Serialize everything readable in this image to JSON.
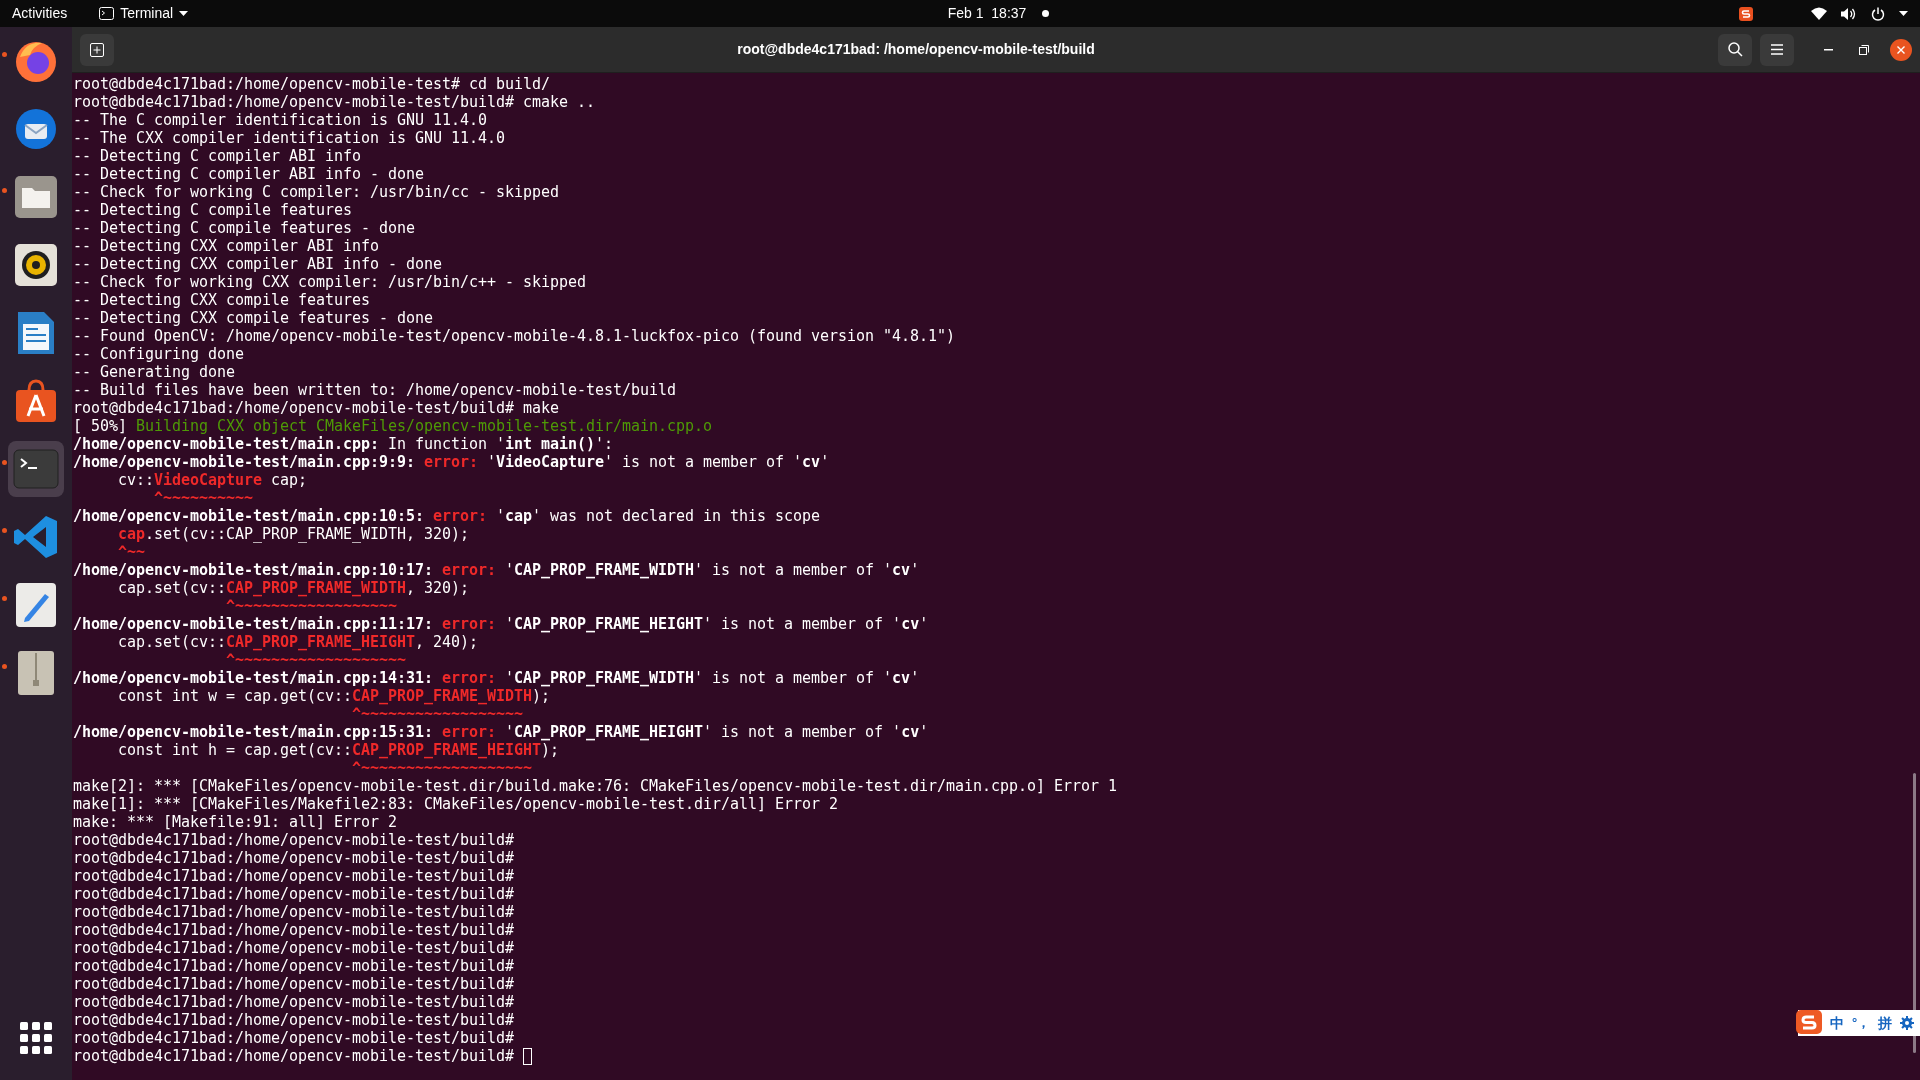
{
  "top_bar": {
    "activities": "Activities",
    "app_menu": "Terminal",
    "clock": "Feb 1  18:37",
    "notification_dot": true
  },
  "dock": [
    {
      "kind": "firefox",
      "running": true,
      "selected": false
    },
    {
      "kind": "thunderbird",
      "running": false,
      "selected": false
    },
    {
      "kind": "files",
      "running": true,
      "selected": false
    },
    {
      "kind": "rhythmbox",
      "running": false,
      "selected": false
    },
    {
      "kind": "writer",
      "running": false,
      "selected": false
    },
    {
      "kind": "appstore",
      "running": false,
      "selected": false
    },
    {
      "kind": "terminal",
      "running": true,
      "selected": true
    },
    {
      "kind": "vscode",
      "running": true,
      "selected": false
    },
    {
      "kind": "editor",
      "running": true,
      "selected": false
    },
    {
      "kind": "archive",
      "running": true,
      "selected": false
    },
    {
      "kind": "appgrid",
      "running": false,
      "selected": false
    }
  ],
  "window": {
    "title": "root@dbde4c171bad: /home/opencv-mobile-test/build"
  },
  "terminal": {
    "cursor_visible": true,
    "lines": [
      {
        "segments": [
          {
            "kind": "plain",
            "text": "root@dbde4c171bad:/home/opencv-mobile-test# cd build/"
          }
        ]
      },
      {
        "segments": [
          {
            "kind": "plain",
            "text": "root@dbde4c171bad:/home/opencv-mobile-test/build# cmake .."
          }
        ]
      },
      {
        "segments": [
          {
            "kind": "plain",
            "text": "-- The C compiler identification is GNU 11.4.0"
          }
        ]
      },
      {
        "segments": [
          {
            "kind": "plain",
            "text": "-- The CXX compiler identification is GNU 11.4.0"
          }
        ]
      },
      {
        "segments": [
          {
            "kind": "plain",
            "text": "-- Detecting C compiler ABI info"
          }
        ]
      },
      {
        "segments": [
          {
            "kind": "plain",
            "text": "-- Detecting C compiler ABI info - done"
          }
        ]
      },
      {
        "segments": [
          {
            "kind": "plain",
            "text": "-- Check for working C compiler: /usr/bin/cc - skipped"
          }
        ]
      },
      {
        "segments": [
          {
            "kind": "plain",
            "text": "-- Detecting C compile features"
          }
        ]
      },
      {
        "segments": [
          {
            "kind": "plain",
            "text": "-- Detecting C compile features - done"
          }
        ]
      },
      {
        "segments": [
          {
            "kind": "plain",
            "text": "-- Detecting CXX compiler ABI info"
          }
        ]
      },
      {
        "segments": [
          {
            "kind": "plain",
            "text": "-- Detecting CXX compiler ABI info - done"
          }
        ]
      },
      {
        "segments": [
          {
            "kind": "plain",
            "text": "-- Check for working CXX compiler: /usr/bin/c++ - skipped"
          }
        ]
      },
      {
        "segments": [
          {
            "kind": "plain",
            "text": "-- Detecting CXX compile features"
          }
        ]
      },
      {
        "segments": [
          {
            "kind": "plain",
            "text": "-- Detecting CXX compile features - done"
          }
        ]
      },
      {
        "segments": [
          {
            "kind": "plain",
            "text": "-- Found OpenCV: /home/opencv-mobile-test/opencv-mobile-4.8.1-luckfox-pico (found version \"4.8.1\")"
          }
        ]
      },
      {
        "segments": [
          {
            "kind": "plain",
            "text": "-- Configuring done"
          }
        ]
      },
      {
        "segments": [
          {
            "kind": "plain",
            "text": "-- Generating done"
          }
        ]
      },
      {
        "segments": [
          {
            "kind": "plain",
            "text": "-- Build files have been written to: /home/opencv-mobile-test/build"
          }
        ]
      },
      {
        "segments": [
          {
            "kind": "plain",
            "text": "root@dbde4c171bad:/home/opencv-mobile-test/build# make"
          }
        ]
      },
      {
        "segments": [
          {
            "kind": "plain",
            "text": "[ 50%] "
          },
          {
            "kind": "green",
            "text": "Building CXX object CMakeFiles/opencv-mobile-test.dir/main.cpp.o"
          }
        ]
      },
      {
        "segments": [
          {
            "kind": "bold",
            "text": "/home/opencv-mobile-test/main.cpp:"
          },
          {
            "kind": "plain",
            "text": " In function '"
          },
          {
            "kind": "bold",
            "text": "int main()"
          },
          {
            "kind": "plain",
            "text": "':"
          }
        ]
      },
      {
        "segments": [
          {
            "kind": "bold",
            "text": "/home/opencv-mobile-test/main.cpp:9:9:"
          },
          {
            "kind": "red",
            "text": " error: "
          },
          {
            "kind": "plain",
            "text": "'"
          },
          {
            "kind": "bold",
            "text": "VideoCapture"
          },
          {
            "kind": "plain",
            "text": "' is not a member of '"
          },
          {
            "kind": "bold",
            "text": "cv"
          },
          {
            "kind": "plain",
            "text": "'"
          }
        ]
      },
      {
        "segments": [
          {
            "kind": "plain",
            "text": "     cv::"
          },
          {
            "kind": "red",
            "text": "VideoCapture"
          },
          {
            "kind": "plain",
            "text": " cap;"
          }
        ]
      },
      {
        "segments": [
          {
            "kind": "red",
            "text": "         ^~~~~~~~~~~"
          }
        ]
      },
      {
        "segments": [
          {
            "kind": "bold",
            "text": "/home/opencv-mobile-test/main.cpp:10:5:"
          },
          {
            "kind": "red",
            "text": " error: "
          },
          {
            "kind": "plain",
            "text": "'"
          },
          {
            "kind": "bold",
            "text": "cap"
          },
          {
            "kind": "plain",
            "text": "' was not declared in this scope"
          }
        ]
      },
      {
        "segments": [
          {
            "kind": "red",
            "text": "     cap"
          },
          {
            "kind": "plain",
            "text": ".set(cv::CAP_PROP_FRAME_WIDTH, 320);"
          }
        ]
      },
      {
        "segments": [
          {
            "kind": "red",
            "text": "     ^~~"
          }
        ]
      },
      {
        "segments": [
          {
            "kind": "bold",
            "text": "/home/opencv-mobile-test/main.cpp:10:17:"
          },
          {
            "kind": "red",
            "text": " error: "
          },
          {
            "kind": "plain",
            "text": "'"
          },
          {
            "kind": "bold",
            "text": "CAP_PROP_FRAME_WIDTH"
          },
          {
            "kind": "plain",
            "text": "' is not a member of '"
          },
          {
            "kind": "bold",
            "text": "cv"
          },
          {
            "kind": "plain",
            "text": "'"
          }
        ]
      },
      {
        "segments": [
          {
            "kind": "plain",
            "text": "     cap.set(cv::"
          },
          {
            "kind": "red",
            "text": "CAP_PROP_FRAME_WIDTH"
          },
          {
            "kind": "plain",
            "text": ", 320);"
          }
        ]
      },
      {
        "segments": [
          {
            "kind": "red",
            "text": "                 ^~~~~~~~~~~~~~~~~~~"
          }
        ]
      },
      {
        "segments": [
          {
            "kind": "bold",
            "text": "/home/opencv-mobile-test/main.cpp:11:17:"
          },
          {
            "kind": "red",
            "text": " error: "
          },
          {
            "kind": "plain",
            "text": "'"
          },
          {
            "kind": "bold",
            "text": "CAP_PROP_FRAME_HEIGHT"
          },
          {
            "kind": "plain",
            "text": "' is not a member of '"
          },
          {
            "kind": "bold",
            "text": "cv"
          },
          {
            "kind": "plain",
            "text": "'"
          }
        ]
      },
      {
        "segments": [
          {
            "kind": "plain",
            "text": "     cap.set(cv::"
          },
          {
            "kind": "red",
            "text": "CAP_PROP_FRAME_HEIGHT"
          },
          {
            "kind": "plain",
            "text": ", 240);"
          }
        ]
      },
      {
        "segments": [
          {
            "kind": "red",
            "text": "                 ^~~~~~~~~~~~~~~~~~~~"
          }
        ]
      },
      {
        "segments": [
          {
            "kind": "bold",
            "text": "/home/opencv-mobile-test/main.cpp:14:31:"
          },
          {
            "kind": "red",
            "text": " error: "
          },
          {
            "kind": "plain",
            "text": "'"
          },
          {
            "kind": "bold",
            "text": "CAP_PROP_FRAME_WIDTH"
          },
          {
            "kind": "plain",
            "text": "' is not a member of '"
          },
          {
            "kind": "bold",
            "text": "cv"
          },
          {
            "kind": "plain",
            "text": "'"
          }
        ]
      },
      {
        "segments": [
          {
            "kind": "plain",
            "text": "     const int w = cap.get(cv::"
          },
          {
            "kind": "red",
            "text": "CAP_PROP_FRAME_WIDTH"
          },
          {
            "kind": "plain",
            "text": ");"
          }
        ]
      },
      {
        "segments": [
          {
            "kind": "red",
            "text": "                               ^~~~~~~~~~~~~~~~~~~"
          }
        ]
      },
      {
        "segments": [
          {
            "kind": "bold",
            "text": "/home/opencv-mobile-test/main.cpp:15:31:"
          },
          {
            "kind": "red",
            "text": " error: "
          },
          {
            "kind": "plain",
            "text": "'"
          },
          {
            "kind": "bold",
            "text": "CAP_PROP_FRAME_HEIGHT"
          },
          {
            "kind": "plain",
            "text": "' is not a member of '"
          },
          {
            "kind": "bold",
            "text": "cv"
          },
          {
            "kind": "plain",
            "text": "'"
          }
        ]
      },
      {
        "segments": [
          {
            "kind": "plain",
            "text": "     const int h = cap.get(cv::"
          },
          {
            "kind": "red",
            "text": "CAP_PROP_FRAME_HEIGHT"
          },
          {
            "kind": "plain",
            "text": ");"
          }
        ]
      },
      {
        "segments": [
          {
            "kind": "red",
            "text": "                               ^~~~~~~~~~~~~~~~~~~~"
          }
        ]
      },
      {
        "segments": [
          {
            "kind": "plain",
            "text": "make[2]: *** [CMakeFiles/opencv-mobile-test.dir/build.make:76: CMakeFiles/opencv-mobile-test.dir/main.cpp.o] Error 1"
          }
        ]
      },
      {
        "segments": [
          {
            "kind": "plain",
            "text": "make[1]: *** [CMakeFiles/Makefile2:83: CMakeFiles/opencv-mobile-test.dir/all] Error 2"
          }
        ]
      },
      {
        "segments": [
          {
            "kind": "plain",
            "text": "make: *** [Makefile:91: all] Error 2"
          }
        ]
      },
      {
        "segments": [
          {
            "kind": "plain",
            "text": "root@dbde4c171bad:/home/opencv-mobile-test/build#"
          }
        ]
      },
      {
        "segments": [
          {
            "kind": "plain",
            "text": "root@dbde4c171bad:/home/opencv-mobile-test/build#"
          }
        ]
      },
      {
        "segments": [
          {
            "kind": "plain",
            "text": "root@dbde4c171bad:/home/opencv-mobile-test/build#"
          }
        ]
      },
      {
        "segments": [
          {
            "kind": "plain",
            "text": "root@dbde4c171bad:/home/opencv-mobile-test/build#"
          }
        ]
      },
      {
        "segments": [
          {
            "kind": "plain",
            "text": "root@dbde4c171bad:/home/opencv-mobile-test/build#"
          }
        ]
      },
      {
        "segments": [
          {
            "kind": "plain",
            "text": "root@dbde4c171bad:/home/opencv-mobile-test/build#"
          }
        ]
      },
      {
        "segments": [
          {
            "kind": "plain",
            "text": "root@dbde4c171bad:/home/opencv-mobile-test/build#"
          }
        ]
      },
      {
        "segments": [
          {
            "kind": "plain",
            "text": "root@dbde4c171bad:/home/opencv-mobile-test/build#"
          }
        ]
      },
      {
        "segments": [
          {
            "kind": "plain",
            "text": "root@dbde4c171bad:/home/opencv-mobile-test/build#"
          }
        ]
      },
      {
        "segments": [
          {
            "kind": "plain",
            "text": "root@dbde4c171bad:/home/opencv-mobile-test/build#"
          }
        ]
      },
      {
        "segments": [
          {
            "kind": "plain",
            "text": "root@dbde4c171bad:/home/opencv-mobile-test/build#"
          }
        ]
      },
      {
        "segments": [
          {
            "kind": "plain",
            "text": "root@dbde4c171bad:/home/opencv-mobile-test/build#"
          }
        ]
      },
      {
        "segments": [
          {
            "kind": "plain",
            "text": "root@dbde4c171bad:/home/opencv-mobile-test/build# "
          }
        ]
      }
    ]
  },
  "input_method": {
    "mode": "中",
    "punctuation": "°，",
    "scheme": "拼"
  }
}
